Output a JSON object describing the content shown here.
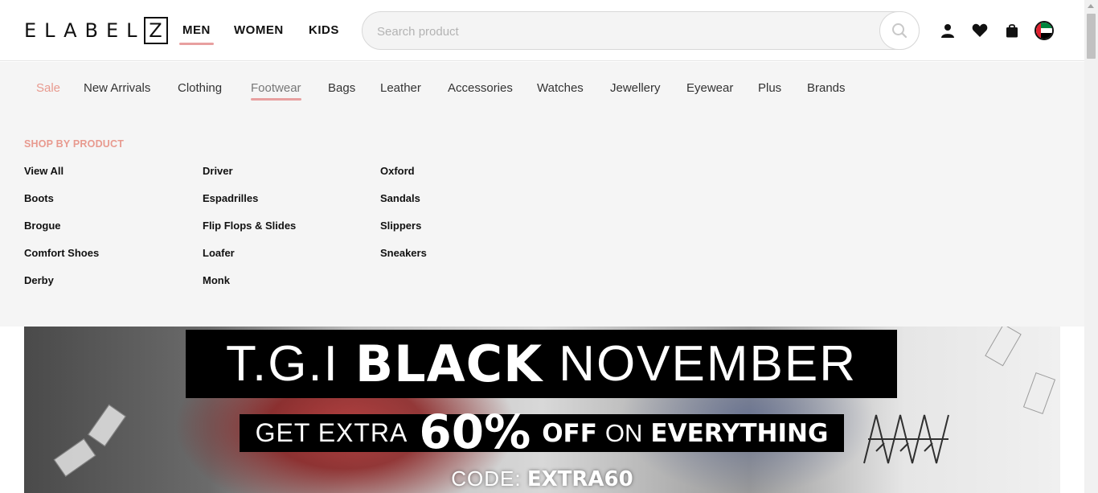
{
  "header": {
    "logo_text": "ELABEL",
    "logo_box_letter": "Z",
    "genders": [
      {
        "label": "MEN",
        "active": true
      },
      {
        "label": "WOMEN",
        "active": false
      },
      {
        "label": "KIDS",
        "active": false
      }
    ],
    "search_placeholder": "Search product",
    "icons": [
      "search-icon",
      "user-icon",
      "heart-icon",
      "bag-icon",
      "uae-flag-icon"
    ]
  },
  "category_nav": [
    {
      "label": "Sale",
      "style": "sale"
    },
    {
      "label": "New Arrivals"
    },
    {
      "label": "Clothing"
    },
    {
      "label": "Footwear",
      "active": true
    },
    {
      "label": "Bags"
    },
    {
      "label": "Leather"
    },
    {
      "label": "Accessories"
    },
    {
      "label": "Watches"
    },
    {
      "label": "Jewellery"
    },
    {
      "label": "Eyewear"
    },
    {
      "label": "Plus"
    },
    {
      "label": "Brands"
    }
  ],
  "mega_menu": {
    "section_title": "SHOP BY PRODUCT",
    "columns": [
      [
        "View All",
        "Boots",
        "Brogue",
        "Comfort Shoes",
        "Derby"
      ],
      [
        "Driver",
        "Espadrilles",
        "Flip Flops & Slides",
        "Loafer",
        "Monk"
      ],
      [
        "Oxford",
        "Sandals",
        "Slippers",
        "Sneakers"
      ]
    ]
  },
  "banner": {
    "headline_prefix": "T.G.I",
    "headline_bold": "BLACK",
    "headline_suffix": "NOVEMBER",
    "offer_prefix": "GET EXTRA",
    "offer_percent": "60%",
    "offer_off": "OFF",
    "offer_on": "ON",
    "offer_everything": "EVERYTHING",
    "code_label": "CODE:",
    "code_value": "EXTRA60"
  },
  "colors": {
    "accent": "#e8a0a0",
    "sale_text": "#e89a8f",
    "menu_bg": "#f5f5f5"
  }
}
